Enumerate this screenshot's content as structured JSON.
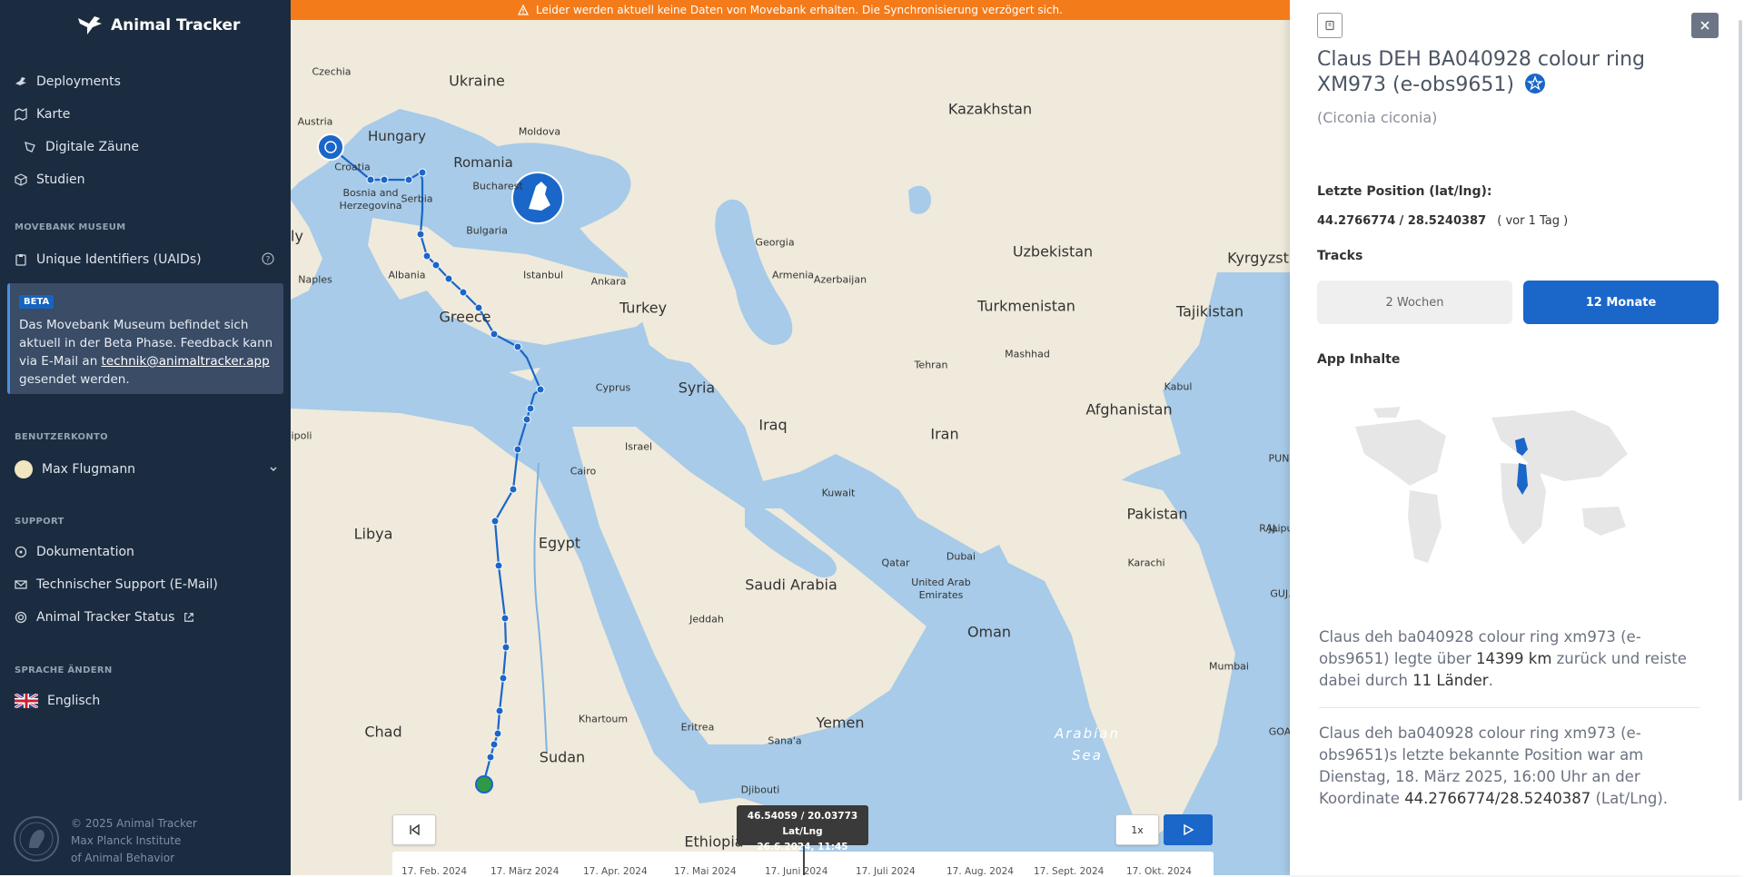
{
  "banner": {
    "text": "Leider werden aktuell keine Daten von Movebank erhalten. Die Synchronisierung verzögert sich."
  },
  "sidebar": {
    "brand": "Animal Tracker",
    "nav": [
      {
        "label": "Deployments"
      },
      {
        "label": "Karte"
      },
      {
        "label": "Digitale Zäune"
      },
      {
        "label": "Studien"
      }
    ],
    "museum_section": "MOVEBANK MUSEUM",
    "uaids": "Unique Identifiers (UAIDs)",
    "beta": {
      "badge": "BETA",
      "text_before": "Das Movebank Museum befindet sich aktuell in der Beta Phase. Feedback kann via E-Mail an ",
      "email": "technik@animaltracker.app",
      "text_after": " gesendet werden."
    },
    "account_section": "BENUTZERKONTO",
    "user_name": "Max Flugmann",
    "support_section": "SUPPORT",
    "support_items": [
      {
        "label": "Dokumentation"
      },
      {
        "label": "Technischer Support (E-Mail)"
      },
      {
        "label": "Animal Tracker Status"
      }
    ],
    "language_section": "SPRACHE ÄNDERN",
    "language": "Englisch",
    "footer": {
      "line1": "© 2025 Animal Tracker",
      "line2": "Max Planck Institute",
      "line3": "of Animal Behavior"
    }
  },
  "map": {
    "countries": [
      "Ukraine",
      "Kazakhstan",
      "Czechia",
      "Hungary",
      "Romania",
      "Moldova",
      "Austria",
      "Croatia",
      "Bosnia and Herzegovina",
      "Serbia",
      "Bulgaria",
      "Uzbekistan",
      "Kyrgyzst",
      "Georgia",
      "Armenia",
      "Azerbaijan",
      "Turkmenistan",
      "Tajikistan",
      "Turkey",
      "Greece",
      "Albania",
      "Cyprus",
      "Syria",
      "Iraq",
      "Iran",
      "Afghanistan",
      "Israel",
      "Libya",
      "Egypt",
      "Saudi Arabia",
      "Pakistan",
      "Oman",
      "Qatar",
      "United Arab Emirates",
      "Chad",
      "Sudan",
      "Yemen",
      "Eritrea",
      "Djibouti",
      "Ethiopia",
      "ly"
    ],
    "cities": [
      "Bucharest",
      "Istanbul",
      "Ankara",
      "Naples",
      "Cairo",
      "Kuwait",
      "Tehran",
      "Mashhad",
      "Kabul",
      "Dubai",
      "Jeddah",
      "Khartoum",
      "Sana'a",
      "Karachi",
      "Mumbai",
      "Jaipu",
      "GOA",
      "GUJ.",
      "RAJ.",
      "PUN",
      "ipoli"
    ],
    "sea": "Arabian Sea",
    "tooltip": {
      "coords": "46.54059 / 20.03773 Lat/Lng",
      "date": "26.6.2024, 11:45"
    },
    "speed_label": "1x",
    "timeline_labels": [
      "17. Feb. 2024",
      "17. März 2024",
      "17. Apr. 2024",
      "17. Mai 2024",
      "17. Juni 2024",
      "17. Juli 2024",
      "17. Aug. 2024",
      "17. Sept. 2024",
      "17. Okt. 2024"
    ]
  },
  "panel": {
    "name": "Claus DEH BA040928 colour ring XM973 (e-obs9651)",
    "species": "(Ciconia ciconia)",
    "last_position_heading": "Letzte Position (lat/lng):",
    "lat": "44.2766774",
    "lng": "28.5240387",
    "ago": "( vor 1 Tag )",
    "tracks_heading": "Tracks",
    "track_options": [
      {
        "label": "2 Wochen",
        "selected": false
      },
      {
        "label": "12 Monate",
        "selected": true
      }
    ],
    "app_content_heading": "App Inhalte",
    "stat1": {
      "before": "Claus deh ba040928 colour ring xm973 (e-obs9651) legte über ",
      "distance": "14399 km",
      "middle": " zurück und reiste dabei durch ",
      "countries": "11 Länder",
      "after": "."
    },
    "stat2": {
      "before": "Claus deh ba040928 colour ring xm973 (e-obs9651)s letzte bekannte Position war am Dienstag, 18. März 2025, 16:00 Uhr an der Koordinate ",
      "coord": "44.2766774/28.5240387",
      "after": " (Lat/Lng)."
    }
  },
  "colors": {
    "sidebar_bg": "#1c2c40",
    "accent": "#1a66c9",
    "banner": "#f47b1a",
    "sea": "#a7cbe9",
    "land": "#efeadb"
  }
}
